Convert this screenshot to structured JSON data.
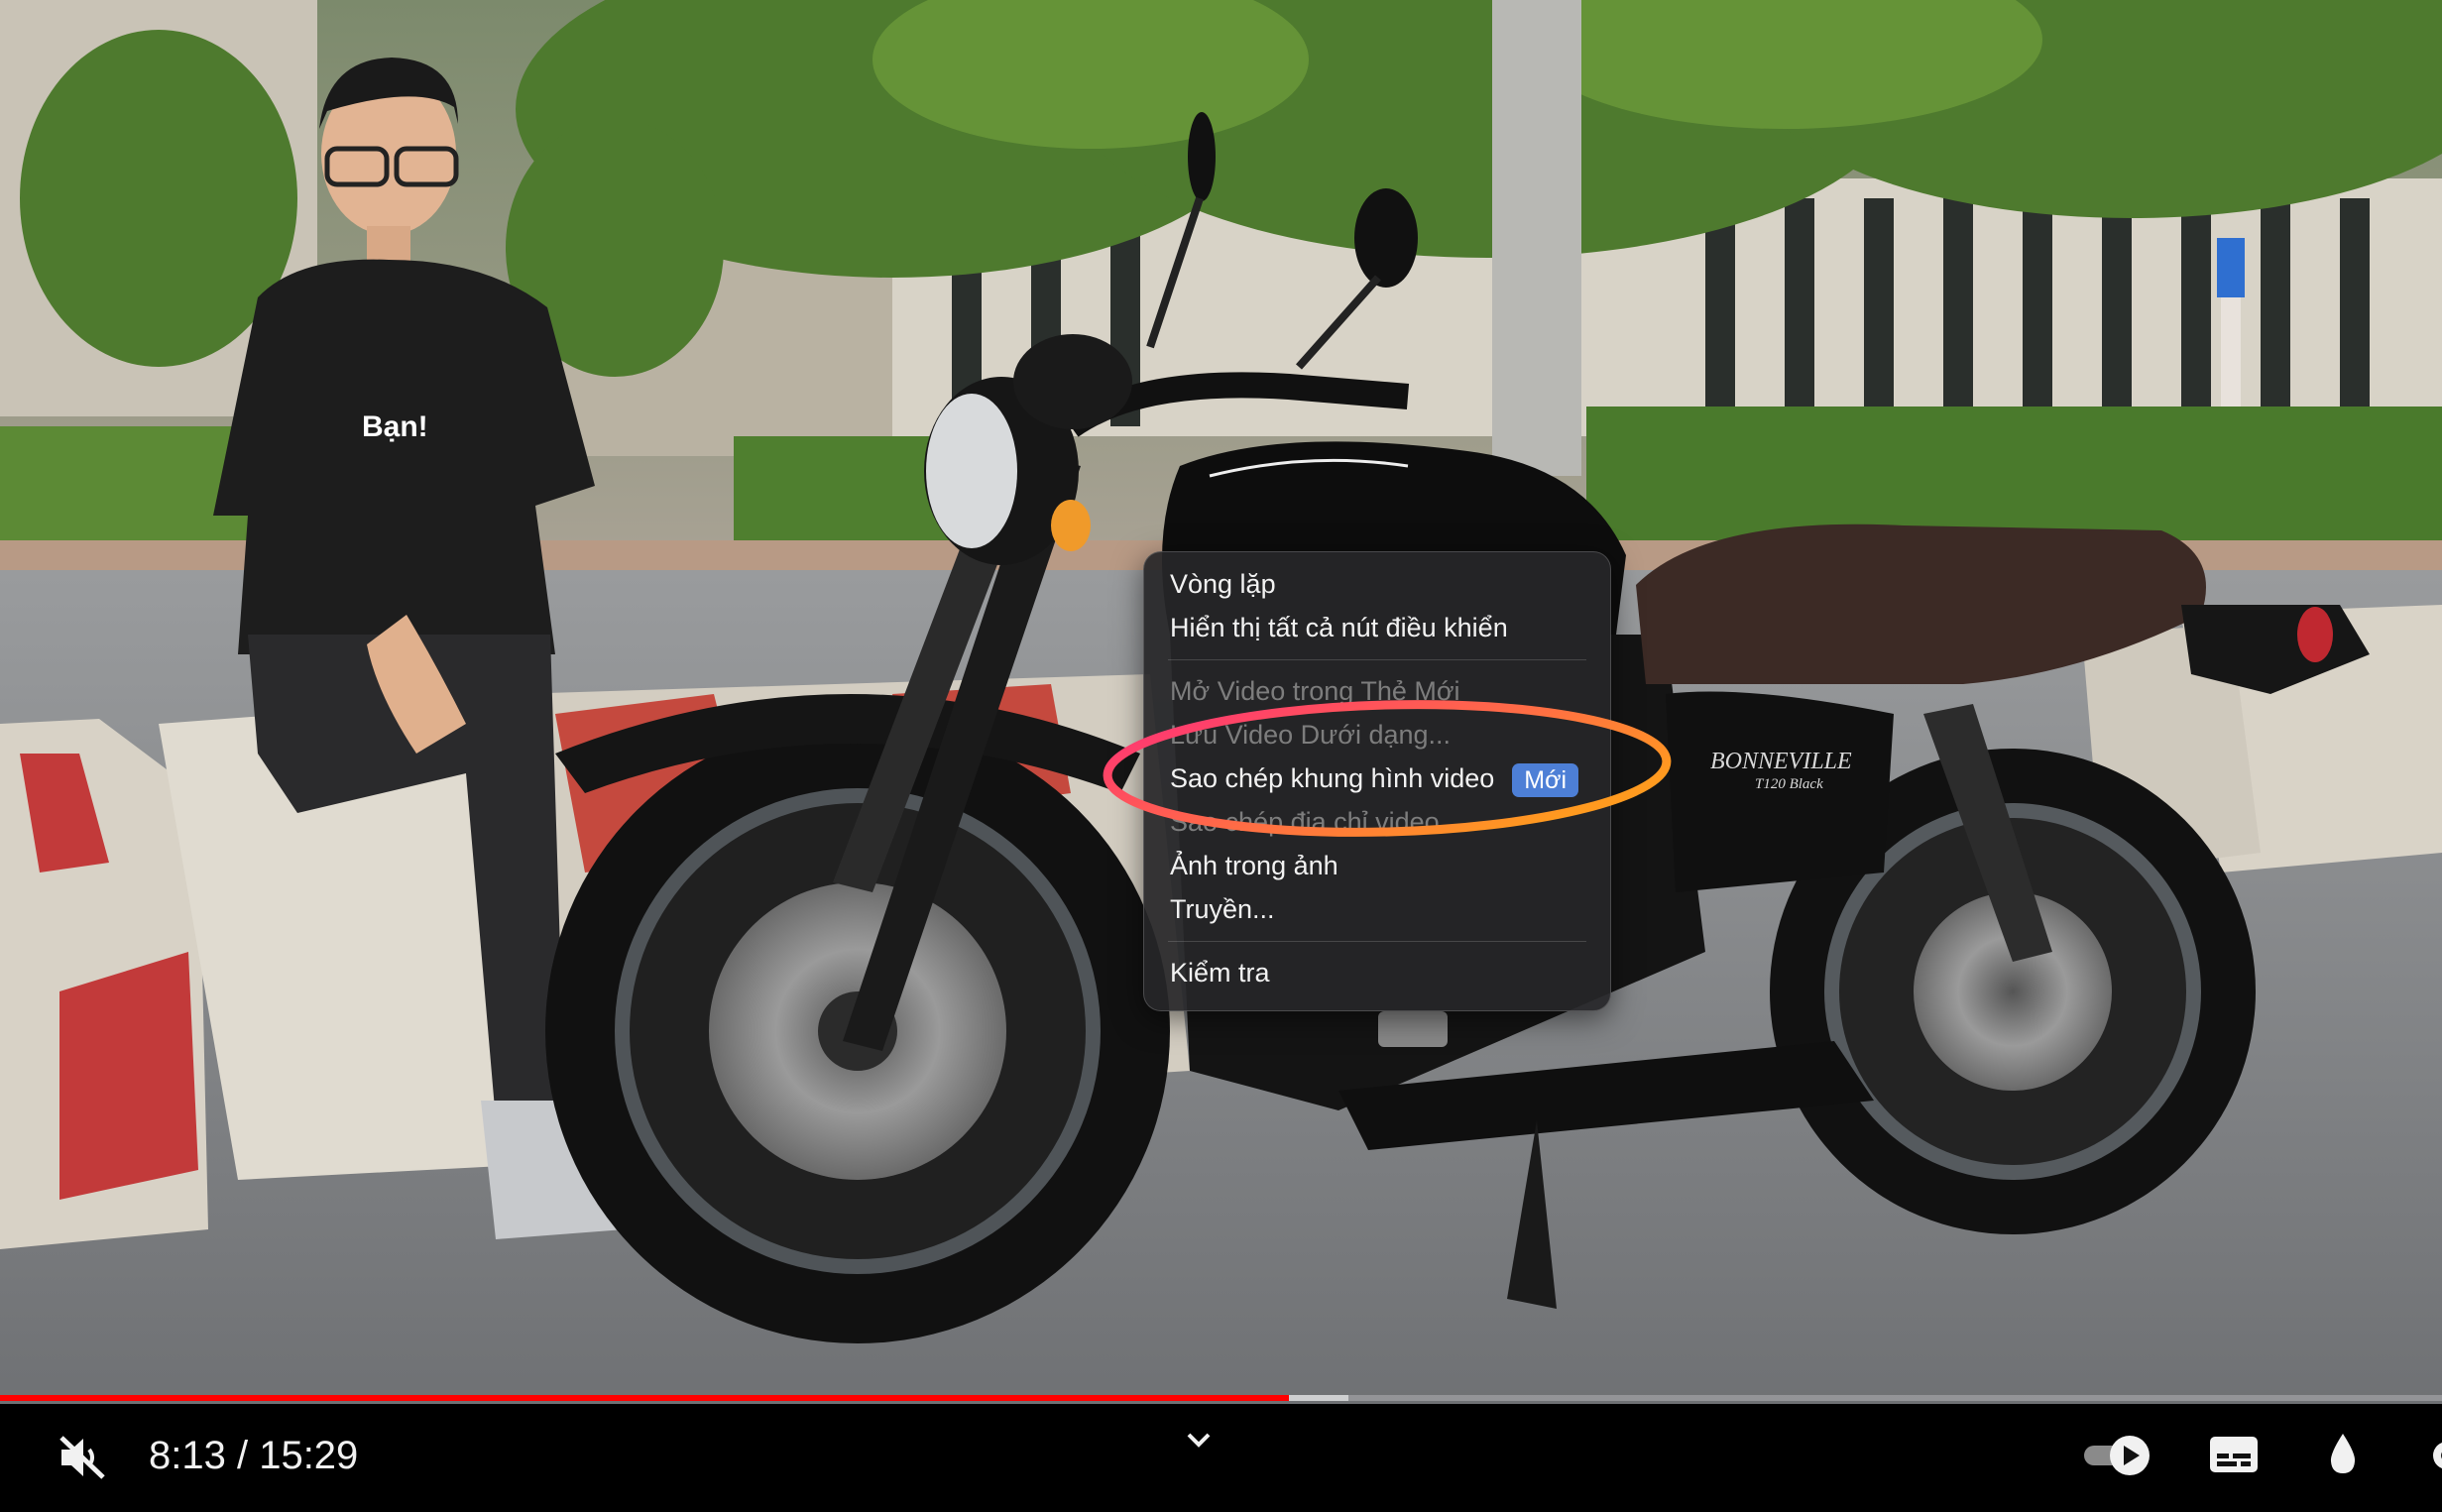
{
  "video": {
    "shirt_text": "Bạn!",
    "bike_brand": "BONNEVILLE",
    "bike_model": "T120 Black"
  },
  "context_menu": {
    "items": [
      {
        "label": "Vòng lặp",
        "enabled": true
      },
      {
        "label": "Hiển thị tất cả nút điều khiển",
        "enabled": true
      },
      {
        "label": "Mở Video trong Thẻ Mới",
        "enabled": false
      },
      {
        "label": "Lưu Video Dưới dạng...",
        "enabled": false
      },
      {
        "label": "Sao chép khung hình video",
        "enabled": true,
        "badge": "Mới"
      },
      {
        "label": "Sao chép địa chỉ video",
        "enabled": false
      },
      {
        "label": "Ảnh trong ảnh",
        "enabled": true
      },
      {
        "label": "Truyền...",
        "enabled": true
      },
      {
        "label": "Kiểm tra",
        "enabled": true
      }
    ],
    "highlight_colors": [
      "#ff2d7a",
      "#ff9a1f"
    ]
  },
  "player": {
    "current_time": "8:13",
    "separator": " / ",
    "duration": "15:29",
    "progress_fraction": 0.528,
    "buffered_fraction": 0.552,
    "accent_color": "#ff0000",
    "mute_icon": "volume-muted-icon",
    "expand_icon": "chevron-down-icon",
    "autoplay_icon": "autoplay-toggle-icon",
    "captions_icon": "subtitles-icon",
    "ambient_icon": "droplet-icon"
  }
}
